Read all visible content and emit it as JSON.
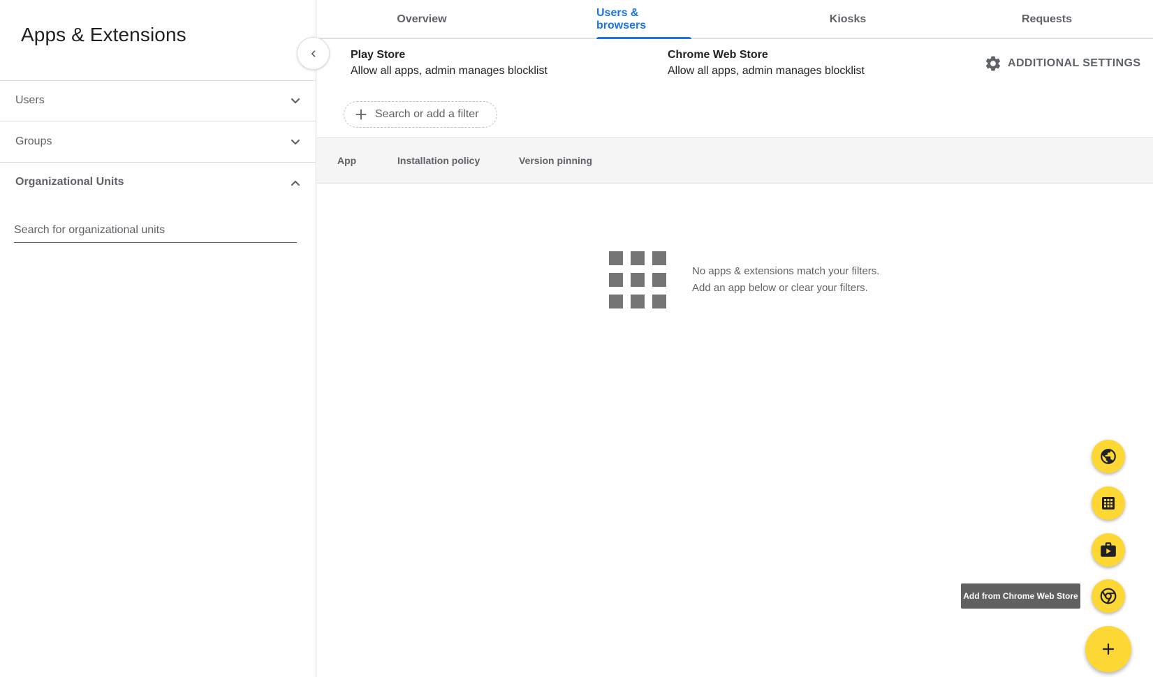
{
  "sidebar": {
    "title": "Apps & Extensions",
    "sections": [
      {
        "label": "Users",
        "expanded": false
      },
      {
        "label": "Groups",
        "expanded": false
      },
      {
        "label": "Organizational Units",
        "expanded": true
      }
    ],
    "org_search": {
      "placeholder": "Search for organizational units",
      "value": ""
    }
  },
  "tabs": [
    {
      "label": "Overview",
      "active": false
    },
    {
      "label": "Users & browsers",
      "active": true
    },
    {
      "label": "Kiosks",
      "active": false
    },
    {
      "label": "Requests",
      "active": false
    }
  ],
  "stores": {
    "play": {
      "name": "Play Store",
      "policy": "Allow all apps, admin manages blocklist"
    },
    "chrome": {
      "name": "Chrome Web Store",
      "policy": "Allow all apps, admin manages blocklist"
    }
  },
  "additional_settings": {
    "label": "ADDITIONAL SETTINGS",
    "icon": "gear-icon"
  },
  "filter": {
    "placeholder": "Search or add a filter",
    "icon": "plus-icon"
  },
  "table": {
    "columns": [
      "App",
      "Installation policy",
      "Version pinning"
    ]
  },
  "empty_state": {
    "line1": "No apps & extensions match your filters.",
    "line2": "Add an app below or clear your filters.",
    "icon": "apps-grid-icon"
  },
  "fab_menu": {
    "items": [
      {
        "icon": "globe-icon"
      },
      {
        "icon": "grid-app-icon"
      },
      {
        "icon": "play-store-icon"
      },
      {
        "icon": "chrome-icon"
      }
    ],
    "tooltip": "Add from Chrome Web Store",
    "main_icon": "plus-icon"
  },
  "colors": {
    "accent": "#1a73e8",
    "fab": "#fdd835",
    "text_secondary": "#5f6368",
    "tooltip_bg": "#616161"
  }
}
